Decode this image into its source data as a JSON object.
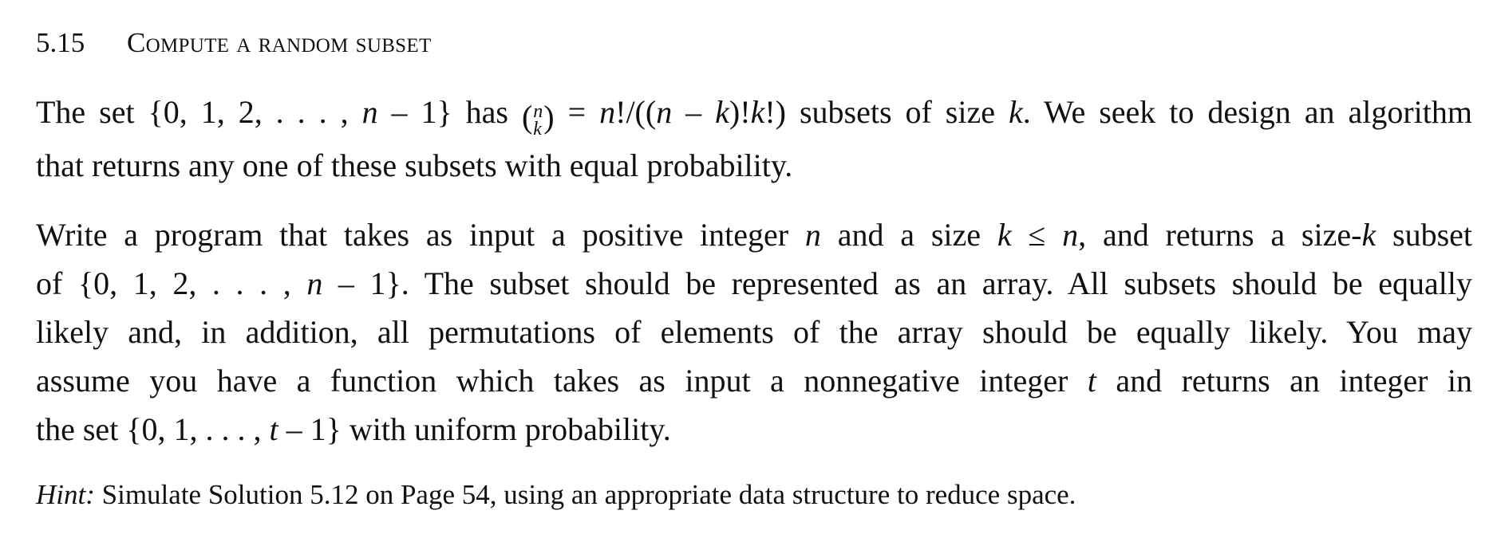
{
  "section": {
    "number": "5.15",
    "title": "Compute a random subset"
  },
  "paragraph1": {
    "line1": {
      "a": "The set {0, 1, 2, . . . , ",
      "n1": "n",
      "b": " – 1} has ",
      "binom_open": "(",
      "binom_top": "n",
      "binom_bottom": "k",
      "binom_close": ")",
      "c": " = ",
      "n2": "n",
      "d": "!/((",
      "n3": "n",
      "e": " – ",
      "k1": "k",
      "f": ")!",
      "k2": "k",
      "g": "!) subsets of size ",
      "k3": "k",
      "h": ".  We seek to design an algorithm"
    },
    "line2": "that returns any one of these subsets with equal probability."
  },
  "paragraph2": {
    "line1": {
      "a": "Write a program that takes as input a positive integer ",
      "n1": "n",
      "b": " and a size ",
      "k1": "k",
      "c": " ≤ ",
      "n2": "n",
      "d": ", and returns a size-",
      "k2": "k",
      "e": " subset"
    },
    "line2": {
      "a": "of {0, 1, 2, . . . , ",
      "n1": "n",
      "b": " – 1}.  The subset should be represented as an array.  All subsets should be equally"
    },
    "line3": "likely and, in addition, all permutations of elements of the array should be equally likely.  You may",
    "line4": {
      "a": "assume you have a function which takes as input a nonnegative integer ",
      "t1": "t",
      "b": " and returns an integer in"
    },
    "line5": {
      "a": "the set {0, 1, . . . , ",
      "t1": "t",
      "b": " – 1} with uniform probability."
    }
  },
  "hint": {
    "label": "Hint:",
    "text": " Simulate Solution 5.12 on Page 54, using an appropriate data structure to reduce space."
  }
}
